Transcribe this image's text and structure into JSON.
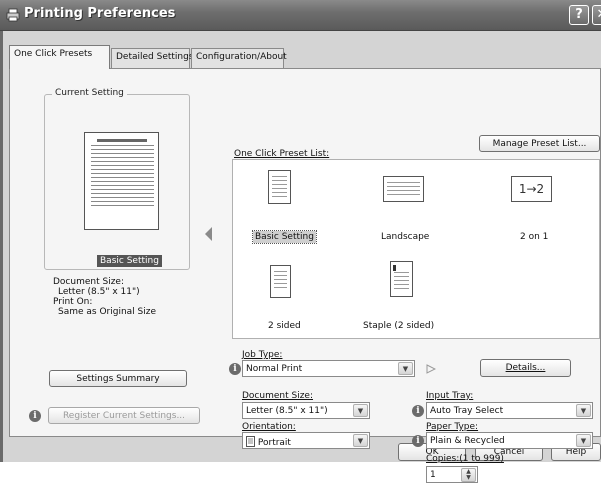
{
  "window": {
    "title": "Printing Preferences",
    "help_glyph": "?",
    "close_glyph": "✕"
  },
  "tabs": [
    {
      "label": "One Click Presets",
      "active": true
    },
    {
      "label": "Detailed Settings",
      "active": false
    },
    {
      "label": "Configuration/About",
      "active": false
    }
  ],
  "current_setting": {
    "legend": "Current Setting",
    "name": "Basic Setting",
    "doc_size_label": "Document Size:",
    "doc_size_value": "Letter (8.5\" x 11\")",
    "print_on_label": "Print On:",
    "print_on_value": "Same as Original Size",
    "summary_button": "Settings Summary",
    "register_button": "Register Current Settings..."
  },
  "presets": {
    "list_label": "One Click Preset List:",
    "manage_button": "Manage Preset List...",
    "items": [
      {
        "label": "Basic Setting",
        "selected": true
      },
      {
        "label": "Landscape",
        "selected": false
      },
      {
        "label": "2 on 1",
        "selected": false,
        "icon_text": "1→2"
      },
      {
        "label": "2 sided",
        "selected": false
      },
      {
        "label": "Staple (2 sided)",
        "selected": false
      }
    ]
  },
  "job_type": {
    "label": "Job Type:",
    "value": "Normal Print",
    "details_button": "Details..."
  },
  "document_size": {
    "label": "Document Size:",
    "value": "Letter (8.5\" x 11\")"
  },
  "orientation": {
    "label": "Orientation:",
    "value": "Portrait"
  },
  "input_tray": {
    "label": "Input Tray:",
    "value": "Auto Tray Select"
  },
  "paper_type": {
    "label": "Paper Type:",
    "value": "Plain & Recycled"
  },
  "copies": {
    "label": "Copies:(1 to 999)",
    "value": "1"
  },
  "footer": {
    "ok": "OK",
    "cancel": "Cancel",
    "help": "Help"
  },
  "colors": {
    "titlebar": "#6e6e6e",
    "panel": "#f5f5f5",
    "dialog": "#d4d4d4"
  }
}
